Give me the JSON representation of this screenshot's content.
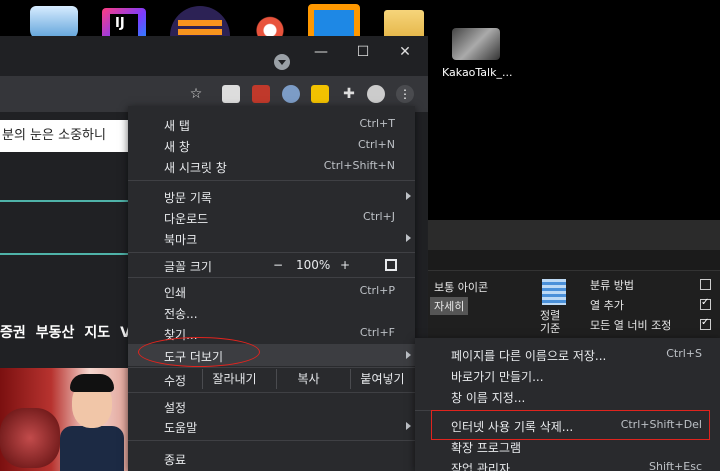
{
  "desktop": {
    "icons": [
      "app-icon",
      "intellij-icon",
      "eclipse-icon",
      "app-icon",
      "app-icon",
      "folder-icon",
      "video-thumbnail"
    ],
    "intellij_text": "IJ",
    "kakao_label": "KakaoTalk_..."
  },
  "chrome": {
    "window_buttons": {
      "minimize": "—",
      "maximize": "☐",
      "close": "✕"
    },
    "notice_text": "분의 눈은 소중하니",
    "nav_items": [
      "증권",
      "부동산",
      "지도",
      "V"
    ]
  },
  "explorer": {
    "layout_items": [
      "보통 아이콘",
      "자세히"
    ],
    "sort_label": "정렬 기준",
    "group_by": "분류 방법",
    "add_column": "열 추가",
    "fit_columns": "모든 열 너비 조정"
  },
  "menu": {
    "new_tab": {
      "label": "새 탭",
      "shortcut": "Ctrl+T"
    },
    "new_window": {
      "label": "새 창",
      "shortcut": "Ctrl+N"
    },
    "incognito": {
      "label": "새 시크릿 창",
      "shortcut": "Ctrl+Shift+N"
    },
    "history": {
      "label": "방문 기록"
    },
    "downloads": {
      "label": "다운로드",
      "shortcut": "Ctrl+J"
    },
    "bookmarks": {
      "label": "북마크"
    },
    "zoom": {
      "label": "글꼴 크기",
      "minus": "−",
      "value": "100%",
      "plus": "+"
    },
    "print": {
      "label": "인쇄",
      "shortcut": "Ctrl+P"
    },
    "cast": {
      "label": "전송..."
    },
    "find": {
      "label": "찾기...",
      "shortcut": "Ctrl+F"
    },
    "more_tools": {
      "label": "도구 더보기"
    },
    "edit": {
      "label": "수정",
      "cut": "잘라내기",
      "copy": "복사",
      "paste": "붙여넣기"
    },
    "settings": {
      "label": "설정"
    },
    "help": {
      "label": "도움말"
    },
    "exit": {
      "label": "종료"
    }
  },
  "submenu": {
    "save_page": {
      "label": "페이지를 다른 이름으로 저장...",
      "shortcut": "Ctrl+S"
    },
    "create_shortcut": {
      "label": "바로가기 만들기..."
    },
    "name_window": {
      "label": "창 이름 지정..."
    },
    "clear_data": {
      "label": "인터넷 사용 기록 삭제...",
      "shortcut": "Ctrl+Shift+Del"
    },
    "extensions": {
      "label": "확장 프로그램"
    },
    "task_manager": {
      "label": "작업 관리자",
      "shortcut": "Shift+Esc"
    }
  },
  "colors": {
    "accent_teal": "#4fb3a9",
    "highlight_red": "#e0241e",
    "menu_bg": "#292a2d"
  }
}
